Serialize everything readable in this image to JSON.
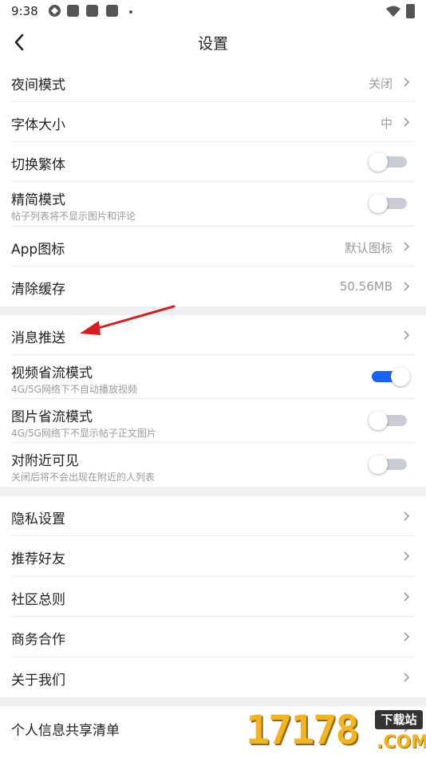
{
  "status_bar": {
    "time": "9:38"
  },
  "header": {
    "title": "设置"
  },
  "sections": [
    {
      "rows": [
        {
          "label": "夜间模式",
          "value": "关闭",
          "type": "nav"
        },
        {
          "label": "字体大小",
          "value": "中",
          "type": "nav"
        },
        {
          "label": "切换繁体",
          "type": "toggle",
          "on": false
        },
        {
          "label": "精简模式",
          "sub": "帖子列表将不显示图片和评论",
          "type": "toggle",
          "on": false
        },
        {
          "label": "App图标",
          "value": "默认图标",
          "type": "nav"
        },
        {
          "label": "清除缓存",
          "value": "50.56MB",
          "type": "nav"
        }
      ]
    },
    {
      "rows": [
        {
          "label": "消息推送",
          "type": "nav"
        },
        {
          "label": "视频省流模式",
          "sub": "4G/5G网络下不自动播放视频",
          "type": "toggle",
          "on": true
        },
        {
          "label": "图片省流模式",
          "sub": "4G/5G网络下不显示帖子正文图片",
          "type": "toggle",
          "on": false
        },
        {
          "label": "对附近可见",
          "sub": "关闭后将不会出现在附近的人列表",
          "type": "toggle",
          "on": false
        }
      ]
    },
    {
      "rows": [
        {
          "label": "隐私设置",
          "type": "nav"
        },
        {
          "label": "推荐好友",
          "type": "nav"
        },
        {
          "label": "社区总则",
          "type": "nav"
        },
        {
          "label": "商务合作",
          "type": "nav"
        },
        {
          "label": "关于我们",
          "type": "nav"
        }
      ]
    },
    {
      "rows": [
        {
          "label": "个人信息共享清单",
          "type": "nav"
        }
      ]
    }
  ],
  "watermark": {
    "digits": "17178",
    "badge": "下载站",
    "suffix": ".COM"
  },
  "colors": {
    "accent": "#1a63f0",
    "annotation": "#d42020",
    "section_gap": "#f0f0f2"
  }
}
